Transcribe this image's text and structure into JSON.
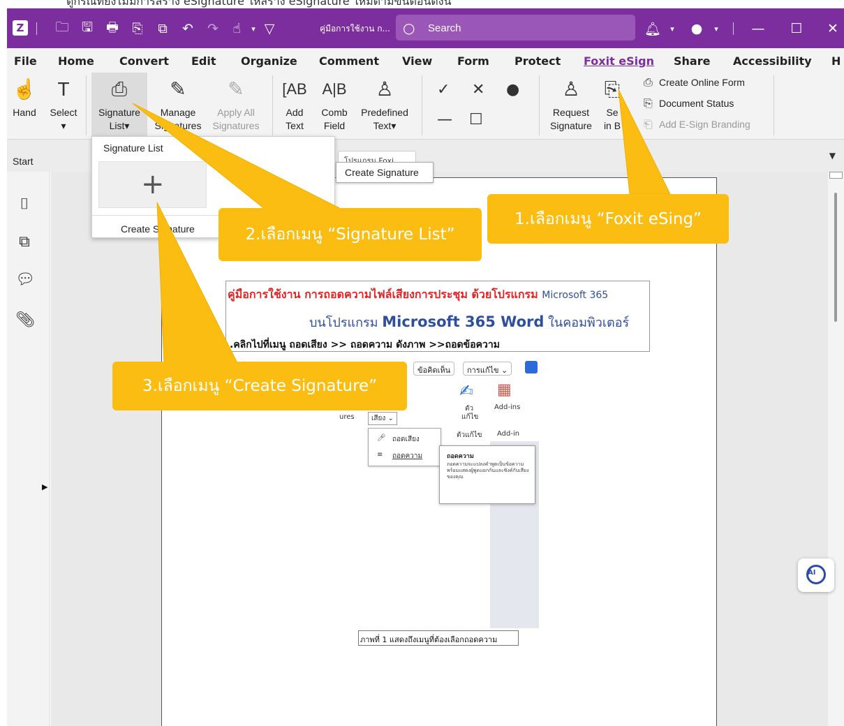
{
  "top_caption": "ดูกรณีที่ยังไม่มีการสร้าง eSignature ให้สร้าง eSignature ใหม่ตามขั้นตอนดังนี้",
  "titlebar": {
    "doc_title": "คู่มือการใช้งาน ก...",
    "search_placeholder": "Search"
  },
  "menu": {
    "tabs": [
      "File",
      "Home",
      "Convert",
      "Edit",
      "Organize",
      "Comment",
      "View",
      "Form",
      "Protect",
      "Foxit eSign",
      "Share",
      "Accessibility",
      "H"
    ],
    "active_tab": "Foxit eSign"
  },
  "ribbon": {
    "hand": "Hand",
    "select": "Select",
    "signature_list_1": "Signature",
    "signature_list_2": "List▾",
    "manage_1": "Manage",
    "manage_2": "Signatures",
    "apply_1": "Apply All",
    "apply_2": "Signatures",
    "add_text_1": "Add",
    "add_text_2": "Text",
    "comb_1": "Comb",
    "comb_2": "Field",
    "predef_1": "Predefined",
    "predef_2": "Text▾",
    "request_1": "Request",
    "request_2": "Signature",
    "send_1": "Se",
    "send_2": "in B",
    "create_online_form": "Create Online Form",
    "document_status": "Document Status",
    "add_branding": "Add E-Sign Branding"
  },
  "subbar": {
    "start": "Start",
    "doc_tab": "โปรแกรม Foxi"
  },
  "dropdown": {
    "header": "Signature List",
    "create": "Create Signature"
  },
  "tooltip": "Create Signature",
  "callouts": {
    "step1": "1.เลือกเมนู “Foxit eSing”",
    "step2": "2.เลือกเมนู “Signature List”",
    "step3": "3.เลือกเมนู “Create Signature”"
  },
  "document": {
    "line1_thai": "คู่มือการใช้งาน การถอดความไฟล์เสียงการประชุม ด้วยโปรแกรม",
    "line1_ms": "Microsoft 365",
    "line2_pre": "บนโปรแกรม",
    "line2_bold": "Microsoft 365 Word",
    "line2_post": "ในคอมพิวเตอร์",
    "line3": ".คลิกไปที่เมนู ถอดเสียง >> ถอดความ ดังภาพ >>ถอดข้อความ",
    "caption": "ภาพที่ 1 แสดงถึงเมนูที่ต้องเลือกถอดความ"
  },
  "embedded": {
    "chip1": "ข้อคิดเห็น",
    "chip2": "การแก้ไข ⌄",
    "ures": "ures",
    "voice_btn": "เสียง ⌄",
    "editor_1": "ตัว",
    "editor_2": "แก้ไข",
    "addins": "Add-ins",
    "editor_group": "ตัวแก้ไข",
    "addin_group": "Add-in",
    "menu_item1": "ถอดเสียง",
    "menu_item2": "ถอดความ",
    "tip_title": "ถอดความ",
    "tip_body": "ถอดความจะแปลงคำพูดเป็นข้อความ พร้อมแสดงผู้พูดแยกกันและซิงค์กับเสียงของคุณ"
  },
  "ai_button": "AI",
  "colors": {
    "titlebar": "#7c2e9e",
    "callout": "#fbbd11",
    "active_tab": "#7c2e9e"
  }
}
